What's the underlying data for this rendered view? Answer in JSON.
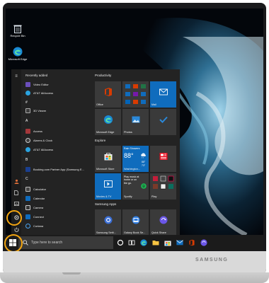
{
  "desktop": {
    "icons": [
      {
        "label": "Recycle Bin"
      },
      {
        "label": "Microsoft Edge"
      }
    ]
  },
  "start_menu": {
    "recently_added_label": "Recently added",
    "recent_apps": [
      "Video Editor",
      "AT&T AllAccess"
    ],
    "sections": [
      {
        "letter": "#",
        "apps": [
          "3D Viewer"
        ]
      },
      {
        "letter": "A",
        "apps": [
          "Access",
          "Alarms & Clock",
          "AT&T AllAccess"
        ]
      },
      {
        "letter": "B",
        "apps": [
          "Booking.com Partner App (Samsung E..."
        ]
      },
      {
        "letter": "C",
        "apps": [
          "Calculator",
          "Calendar",
          "Camera",
          "Connect",
          "Cortana"
        ]
      }
    ],
    "groups": {
      "productivity": "Productivity",
      "explore": "Explore",
      "samsung_apps": "Samsung Apps"
    },
    "tiles": {
      "office": "Office",
      "mail": "Mail",
      "edge": "Microsoft Edge",
      "photos": "Photos",
      "store": "Microsoft Store",
      "weather_condition": "Rain Showers",
      "weather_temp": "88°",
      "weather_city": "Washington...",
      "weather_hi": "88°",
      "weather_lo": "73°",
      "news": "",
      "movies": "Movies & TV",
      "spotify_line1": "Play music at",
      "spotify_line2": "home or on",
      "spotify_line3": "the go.",
      "spotify": "Spotify",
      "play": "Play",
      "samsung_settings": "Samsung Setti...",
      "galaxy_book": "Galaxy Book Se...",
      "quick_share": "Quick Share"
    }
  },
  "taskbar": {
    "search_placeholder": "Type here to search"
  },
  "laptop": {
    "brand": "SAMSUNG"
  },
  "colors": {
    "highlight": "#f3a511",
    "tile_blue": "#0f6cbd",
    "office_red": "#d83b01"
  }
}
